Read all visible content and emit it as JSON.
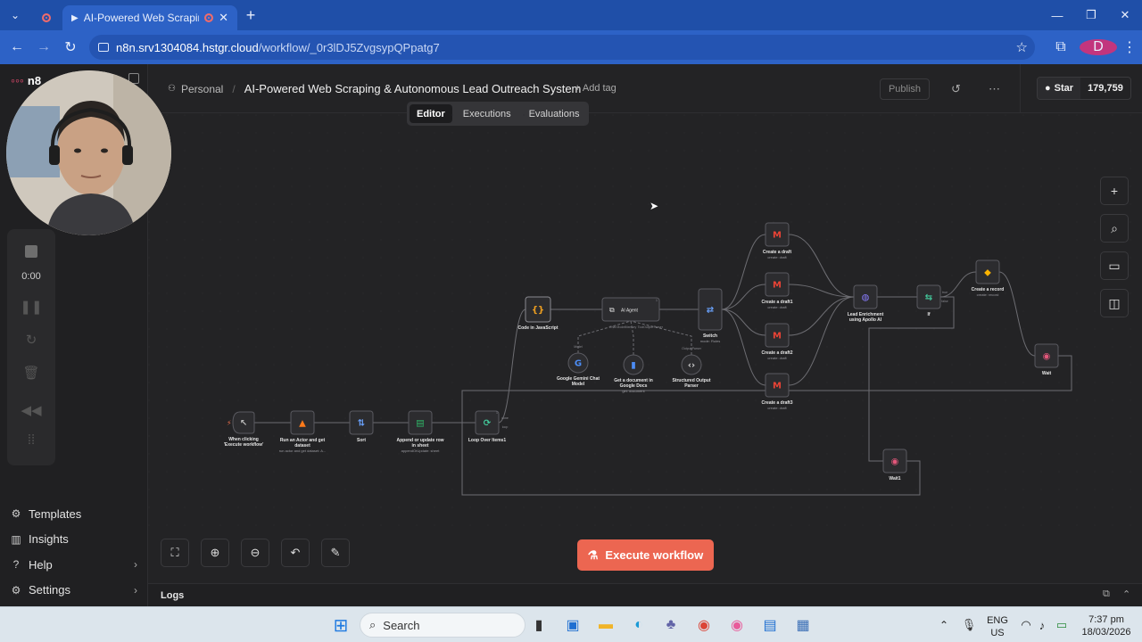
{
  "browser": {
    "tabs": [
      {
        "title": "",
        "icon": "record-icon"
      },
      {
        "title": "AI-Powered Web Scraping",
        "icon": "record-icon"
      }
    ],
    "url_host": "n8n.srv1304084.hstgr.cloud",
    "url_path": "/workflow/_0r3lDJ5ZvgsypQPpatg7",
    "profile_initial": "D"
  },
  "sidebar": {
    "logo_text": "n8",
    "recorder_time": "0:00",
    "links": [
      {
        "label": "Templates",
        "icon": "templates-icon"
      },
      {
        "label": "Insights",
        "icon": "insights-icon"
      },
      {
        "label": "Help",
        "icon": "help-icon"
      },
      {
        "label": "Settings",
        "icon": "settings-icon"
      }
    ]
  },
  "header": {
    "project": "Personal",
    "workflow_title": "AI-Powered Web Scraping & Autonomous Lead Outreach System",
    "add_tag": "+ Add tag",
    "publish": "Publish",
    "github_star": "Star",
    "github_count": "179,759",
    "view_tabs": [
      "Editor",
      "Executions",
      "Evaluations"
    ],
    "active_view": "Editor"
  },
  "workflow": {
    "nodes": [
      {
        "id": "trigger",
        "label": "When clicking 'Execute workflow'",
        "sub": "",
        "icon": "↖",
        "color": "#bbbbbb"
      },
      {
        "id": "apify",
        "label": "Run an Actor and get dataset",
        "sub": "run actor and get dataset: A...",
        "icon": "▲",
        "color": "#ff7a1a"
      },
      {
        "id": "sort",
        "label": "Sort",
        "sub": "",
        "icon": "⇅",
        "color": "#6aa3ff"
      },
      {
        "id": "sheets",
        "label": "Append or update row in sheet",
        "sub": "appendOrUpdate: sheet",
        "icon": "▤",
        "color": "#2fb567"
      },
      {
        "id": "loop",
        "label": "Loop Over Items1",
        "sub": "",
        "icon": "⟳",
        "color": "#43c79a"
      },
      {
        "id": "code",
        "label": "Code in JavaScript",
        "sub": "",
        "icon": "{}",
        "color": "#f0a020"
      },
      {
        "id": "agent",
        "label": "AI Agent",
        "sub": "",
        "icon": "⧉",
        "color": "#dddddd"
      },
      {
        "id": "gemini",
        "label": "Google Gemini Chat Model",
        "sub": "",
        "icon": "G",
        "color": "#4c8df6"
      },
      {
        "id": "docs",
        "label": "Get a document in Google Docs",
        "sub": "get: document",
        "icon": "▮",
        "color": "#4c8df6"
      },
      {
        "id": "parser",
        "label": "Structured Output Parser",
        "sub": "",
        "icon": "‹›",
        "color": "#cccccc"
      },
      {
        "id": "switch",
        "label": "Switch",
        "sub": "mode: Rules",
        "icon": "⇄",
        "color": "#6aa3ff"
      },
      {
        "id": "draft",
        "label": "Create a draft",
        "sub": "create: draft",
        "icon": "M",
        "color": "#ea4335"
      },
      {
        "id": "draft1",
        "label": "Create a draft1",
        "sub": "create: draft",
        "icon": "M",
        "color": "#ea4335"
      },
      {
        "id": "draft2",
        "label": "Create a draft2",
        "sub": "create: draft",
        "icon": "M",
        "color": "#ea4335"
      },
      {
        "id": "draft3",
        "label": "Create a draft3",
        "sub": "create: draft",
        "icon": "M",
        "color": "#ea4335"
      },
      {
        "id": "apollo",
        "label": "Lead Enrichment using Apollo AI",
        "sub": "",
        "icon": "◍",
        "color": "#8a7dff"
      },
      {
        "id": "if",
        "label": "If",
        "sub": "",
        "icon": "⇆",
        "color": "#43c79a"
      },
      {
        "id": "airtable",
        "label": "Create a record",
        "sub": "create: record",
        "icon": "◆",
        "color": "#fcb400"
      },
      {
        "id": "wait",
        "label": "Wait",
        "sub": "",
        "icon": "◉",
        "color": "#e4577b"
      },
      {
        "id": "wait1",
        "label": "Wait1",
        "sub": "",
        "icon": "◉",
        "color": "#e4577b"
      }
    ],
    "port_labels": {
      "agent_model": "Chat Model",
      "agent_memory": "Memory",
      "agent_tool": "Tool",
      "agent_parser": "Output Parser",
      "gemini_port": "Model",
      "parser_port": "Output Parser",
      "loop_done": "done",
      "loop_loop": "loop",
      "if_true": "true",
      "if_false": "false",
      "agent_badge": "1",
      "loop_badge": "1"
    }
  },
  "canvas": {
    "execute_label": "Execute workflow",
    "logs_label": "Logs"
  },
  "taskbar": {
    "search_placeholder": "Search",
    "lang_top": "ENG",
    "lang_bottom": "US",
    "time": "7:37 pm",
    "date": "18/03/2026"
  }
}
